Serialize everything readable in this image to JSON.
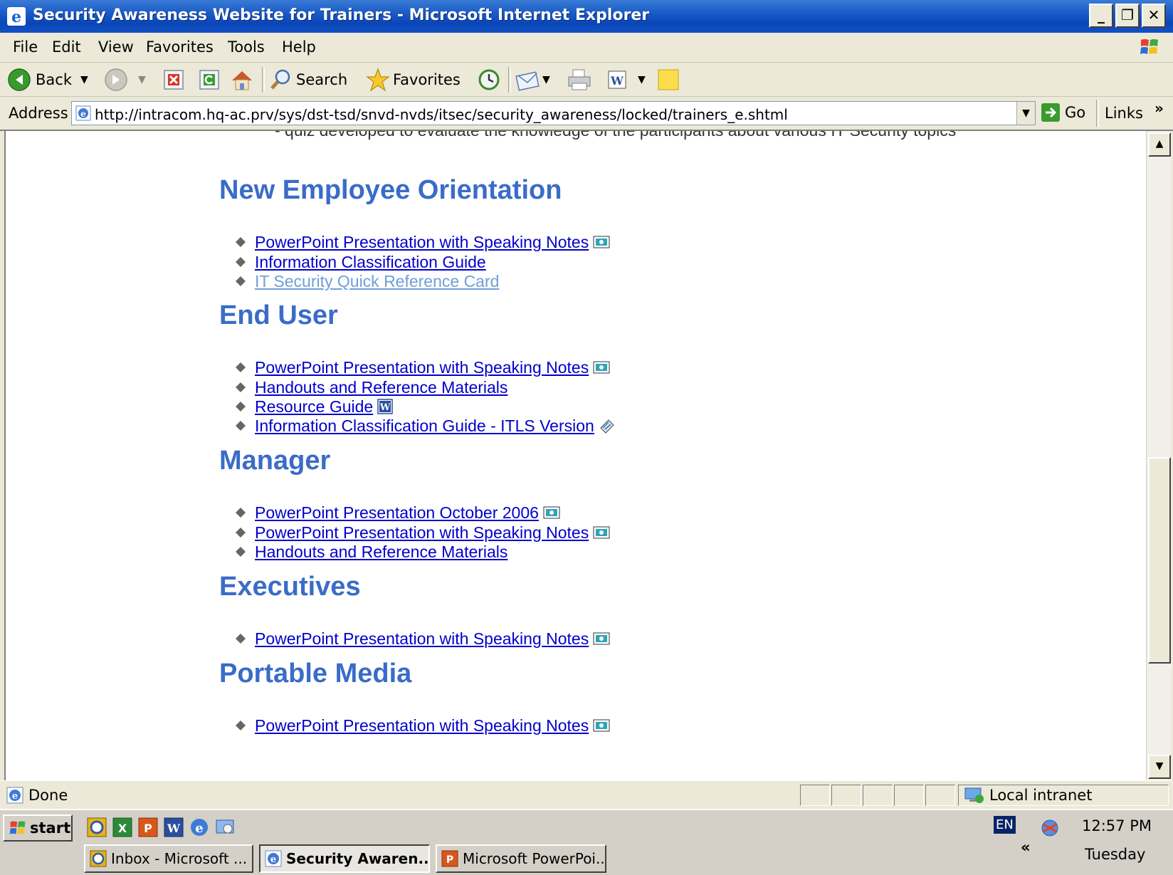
{
  "window": {
    "title": "Security Awareness Website for Trainers - Microsoft Internet Explorer",
    "min_glyph": "_",
    "max_glyph": "❐",
    "close_glyph": "✕"
  },
  "menu": [
    "File",
    "Edit",
    "View",
    "Favorites",
    "Tools",
    "Help"
  ],
  "toolbar": {
    "back_label": "Back",
    "search_label": "Search",
    "favorites_label": "Favorites"
  },
  "address": {
    "label": "Address",
    "url": "http://intracom.hq-ac.prv/sys/dst-tsd/snvd-nvds/itsec/security_awareness/locked/trainers_e.shtml",
    "go_label": "Go",
    "links_label": "Links",
    "links_chevron": "»"
  },
  "content": {
    "quiz_line": "- quiz developed to evaluate the knowledge of the participants about various IT Security topics",
    "sections": [
      {
        "title": "New Employee Orientation",
        "links": [
          {
            "text": "PowerPoint Presentation with Speaking Notes",
            "icon": "powerpoint-icon"
          },
          {
            "text": "Information Classification Guide",
            "icon": ""
          },
          {
            "text": "IT Security Quick Reference Card",
            "icon": "",
            "visited": true
          }
        ]
      },
      {
        "title": "End User",
        "links": [
          {
            "text": "PowerPoint Presentation with Speaking Notes",
            "icon": "powerpoint-icon"
          },
          {
            "text": "Handouts and Reference Materials",
            "icon": ""
          },
          {
            "text": "Resource Guide",
            "icon": "word-icon"
          },
          {
            "text": "Information Classification Guide - ITLS Version",
            "icon": "document-icon"
          }
        ]
      },
      {
        "title": "Manager",
        "links": [
          {
            "text": "PowerPoint Presentation October 2006",
            "icon": "powerpoint-icon"
          },
          {
            "text": "PowerPoint Presentation with Speaking Notes",
            "icon": "powerpoint-icon"
          },
          {
            "text": "Handouts and Reference Materials",
            "icon": ""
          }
        ]
      },
      {
        "title": "Executives",
        "links": [
          {
            "text": "PowerPoint Presentation with Speaking Notes",
            "icon": "powerpoint-icon"
          }
        ]
      },
      {
        "title": "Portable Media",
        "links": [
          {
            "text": "PowerPoint Presentation with Speaking Notes",
            "icon": "powerpoint-icon"
          }
        ]
      }
    ]
  },
  "status": {
    "text": "Done",
    "zone": "Local intranet"
  },
  "taskbar": {
    "start_label": "start",
    "tasks": [
      {
        "label": "Inbox - Microsoft ...",
        "icon": "outlook-icon",
        "active": false
      },
      {
        "label": "Security Awaren...",
        "icon": "ie-icon",
        "active": true
      },
      {
        "label": "Microsoft PowerPoi...",
        "icon": "powerpoint-icon",
        "active": false
      }
    ],
    "lang": "EN",
    "tray_chevron": "«",
    "time": "12:57 PM",
    "day": "Tuesday"
  },
  "colors": {
    "heading": "#3a6cc8",
    "link": "#0000cc",
    "visited_link": "#6f9fd8",
    "titlebar": "#0a46b8"
  }
}
